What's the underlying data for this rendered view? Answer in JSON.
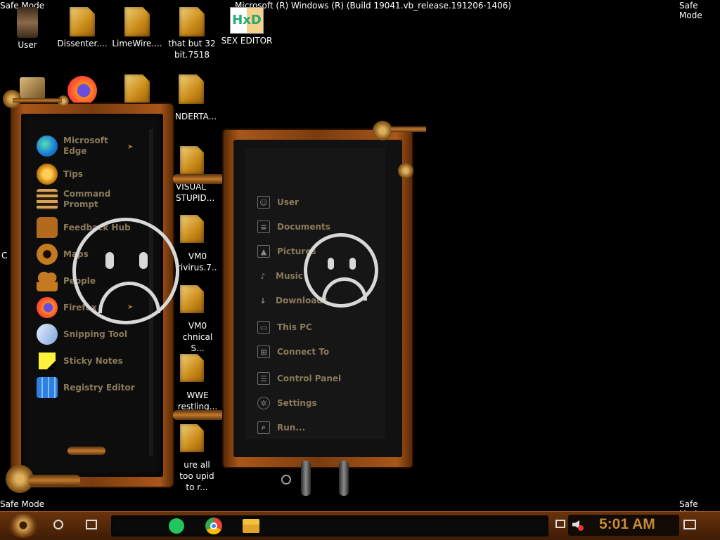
{
  "os": {
    "safe_mode": "Safe Mode",
    "safe_mode_partial": "Safe Mode",
    "build": "Microsoft (R) Windows (R) (Build 19041.vb_release.191206-1406)"
  },
  "desktop_icons": [
    {
      "label": "User"
    },
    {
      "label": "Dissenter...."
    },
    {
      "label": "LimeWire...."
    },
    {
      "label": "that but 32 bit.7518"
    },
    {
      "label": "SEX EDITOR"
    }
  ],
  "partial_icons": [
    {
      "label": "NDERTA..."
    },
    {
      "label": "VISUAL STUPID..."
    },
    {
      "label": "VM0 rivirus.7..."
    },
    {
      "label": "VM0 chnical S..."
    },
    {
      "label": "WWE restling..."
    },
    {
      "label": "ure all too upid to r..."
    }
  ],
  "start_apps": [
    {
      "label": "Microsoft Edge",
      "icon": "edge-icon",
      "has_arrow": true
    },
    {
      "label": "Tips",
      "icon": "lightbulb-icon"
    },
    {
      "label": "Command Prompt",
      "icon": "command-prompt-icon"
    },
    {
      "label": "Feedback Hub",
      "icon": "feedback-icon"
    },
    {
      "label": "Maps",
      "icon": "maps-icon"
    },
    {
      "label": "People",
      "icon": "people-icon"
    },
    {
      "label": "Firefox",
      "icon": "firefox-icon",
      "has_arrow": true
    },
    {
      "label": "Snipping Tool",
      "icon": "scissors-icon"
    },
    {
      "label": "Sticky Notes",
      "icon": "sticky-note-icon"
    },
    {
      "label": "Registry Editor",
      "icon": "registry-icon"
    }
  ],
  "places": [
    {
      "label": "User",
      "icon": "user-icon"
    },
    {
      "label": "Documents",
      "icon": "document-icon"
    },
    {
      "label": "Pictures",
      "icon": "picture-icon"
    },
    {
      "label": "Music",
      "icon": "music-icon"
    },
    {
      "label": "Downloads",
      "icon": "download-icon"
    },
    {
      "label": "This PC",
      "icon": "monitor-icon"
    },
    {
      "label": "Connect To",
      "icon": "network-icon"
    },
    {
      "label": "Control Panel",
      "icon": "control-panel-icon"
    },
    {
      "label": "Settings",
      "icon": "gear-icon"
    },
    {
      "label": "Run...",
      "icon": "run-icon"
    }
  ],
  "edge_partial": {
    "left_c": "C"
  },
  "taskbar": {
    "clock": "5:01 AM",
    "pinned": [
      {
        "name": "notes-app-icon",
        "color": "#22c55e"
      },
      {
        "name": "chrome-icon",
        "color": "#ea4335"
      },
      {
        "name": "file-explorer-icon",
        "color": "#f3c13a"
      }
    ]
  },
  "colors": {
    "accent": "#c58a35",
    "copper": "#a9561a",
    "menu_text": "#8a7a5a"
  }
}
